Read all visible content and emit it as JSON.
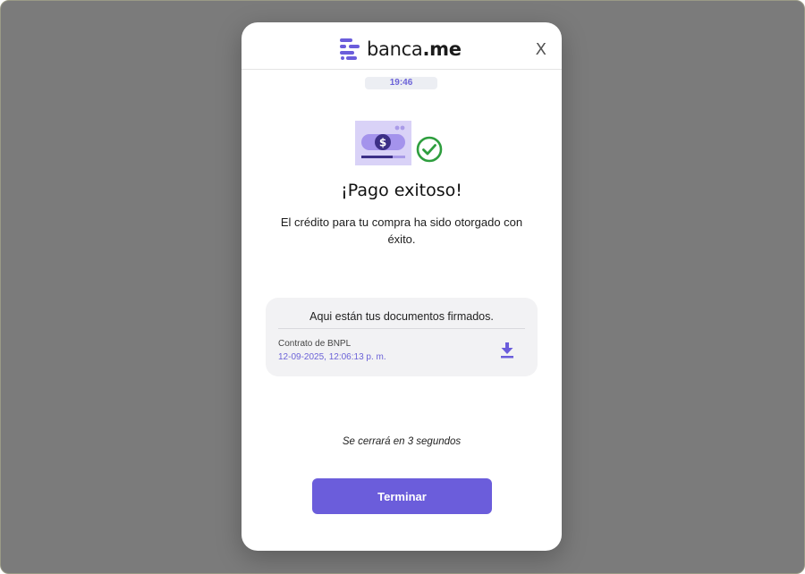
{
  "brand": {
    "name_prefix": "banca",
    "name_suffix": ".me",
    "logo_icon": "banca-logo-icon"
  },
  "header": {
    "close_label": "X",
    "timer": "19:46"
  },
  "main": {
    "title": "¡Pago exitoso!",
    "subtitle": "El crédito para tu compra ha sido otorgado con éxito.",
    "illustration_icons": [
      "payment-card-icon",
      "check-circle-icon"
    ]
  },
  "documents": {
    "heading": "Aqui están tus documentos firmados.",
    "items": [
      {
        "name": "Contrato de BNPL",
        "date": "12-09-2025, 12:06:13 p. m.",
        "icon": "download-icon"
      }
    ]
  },
  "footer": {
    "closing_note": "Se cerrará en 3 segundos",
    "finish_label": "Terminar"
  },
  "colors": {
    "accent": "#6b5ddb",
    "accent_text": "#6c63d8",
    "success_green": "#2e9e3e",
    "backdrop": "#7b7b7b",
    "card_bg": "#f2f2f4"
  }
}
